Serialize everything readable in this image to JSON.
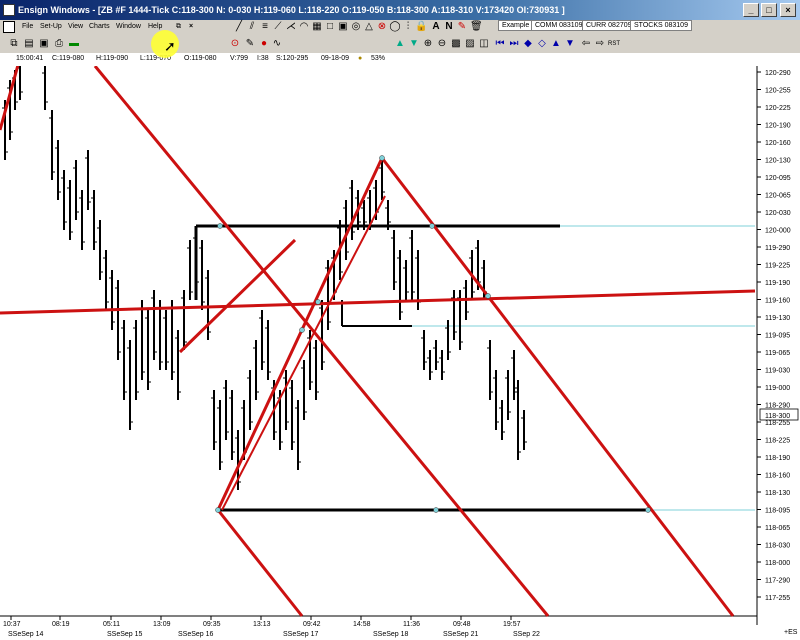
{
  "window": {
    "title": "Ensign Windows - [ZB #F 1444-Tick C:118-300 N: 0-030 H:119-060 L:118-220 O:119-050 B:118-300 A:118-310 V:173420 OI:730931 ]",
    "minimize": "_",
    "maximize": "□",
    "close": "×"
  },
  "menu": {
    "file": "File",
    "setup": "Set-Up",
    "view": "View",
    "charts": "Charts",
    "window": "Window",
    "help": "Help"
  },
  "tabs": [
    "Example",
    "COMM 083109",
    "CURR 082709",
    "STOCKS 083109"
  ],
  "status": {
    "time": "15:00:41",
    "c": "C:119-080",
    "h": "H:119-090",
    "l": "L:119-070",
    "o": "O:119-080",
    "v": "V:799",
    "i": "I:38",
    "s": "S:120-295",
    "date": "09-18-09",
    "zoom": "53%"
  },
  "price_labels": [
    "120-290",
    "120-255",
    "120-225",
    "120-190",
    "120-160",
    "120-130",
    "120-095",
    "120-065",
    "120-030",
    "120-000",
    "119-290",
    "119-225",
    "119-190",
    "119-160",
    "119-130",
    "119-095",
    "119-065",
    "119-030",
    "119-000",
    "118-290",
    "118-255",
    "118-225",
    "118-190",
    "118-160",
    "118-130",
    "118-095",
    "118-065",
    "118-030",
    "118-000",
    "117-290",
    "117-255"
  ],
  "current_price": "118-300",
  "es_label": "+ES",
  "time_labels": [
    "10:37",
    "08:19",
    "05:11",
    "13:09",
    "09:35",
    "13:13",
    "09:42",
    "14:58",
    "11:36",
    "09:48",
    "19:57"
  ],
  "date_labels": [
    "SSeSep 14",
    "SSeSep 15",
    "SSeSep 16",
    "SSeSep 17",
    "SSeSep 18",
    "SSeSep 21",
    "SSep 22"
  ],
  "colors": {
    "trend": "#cc1111",
    "level": "#000000",
    "extension": "#7fd0d8",
    "bars": "#000000"
  }
}
